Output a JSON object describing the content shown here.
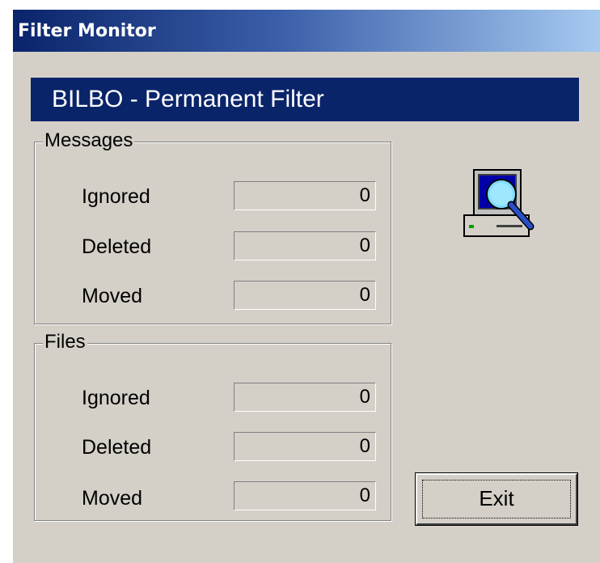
{
  "window": {
    "title": "Filter Monitor"
  },
  "banner": {
    "text": "BILBO - Permanent Filter"
  },
  "messages": {
    "group_label": "Messages",
    "rows": [
      {
        "label": "Ignored",
        "value": "0"
      },
      {
        "label": "Deleted",
        "value": "0"
      },
      {
        "label": "Moved",
        "value": "0"
      }
    ]
  },
  "files": {
    "group_label": "Files",
    "rows": [
      {
        "label": "Ignored",
        "value": "0"
      },
      {
        "label": "Deleted",
        "value": "0"
      },
      {
        "label": "Moved",
        "value": "0"
      }
    ]
  },
  "icon": {
    "name": "monitor-magnifier-icon"
  },
  "buttons": {
    "exit_label": "Exit"
  },
  "colors": {
    "titlebar_start": "#0a246a",
    "titlebar_end": "#a6caf0",
    "banner_background": "#0a246a",
    "dialog_background": "#d4d0c8"
  }
}
